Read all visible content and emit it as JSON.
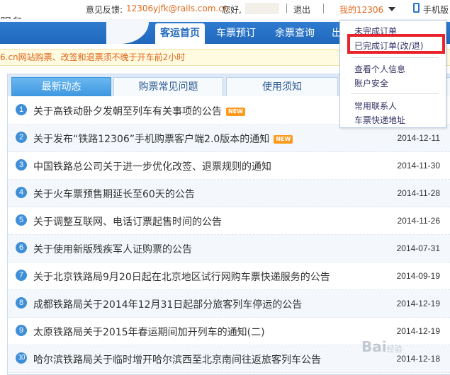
{
  "header": {
    "brand_fragment": "服务",
    "feedback_label": "意见反馈:",
    "feedback_email": "12306yjfk@rails.com.cn",
    "greeting": "您好,",
    "logout": "退出",
    "my_account": "我的12306",
    "mobile": "手机版"
  },
  "nav": {
    "items": [
      "客运首页",
      "车票预订",
      "余票查询",
      "出行"
    ]
  },
  "notice": {
    "text": "6.cn网站购票、改签和退票须不晚于开车前2小时"
  },
  "tabs": [
    "最新动态",
    "购票常见问题",
    "使用须知",
    ""
  ],
  "news": [
    {
      "num": "1",
      "title": "关于高铁动卧夕发朝至列车有关事项的公告",
      "badge": "NEW",
      "date": ""
    },
    {
      "num": "2",
      "title": "关于发布“铁路12306”手机购票客户端2.0版本的通知",
      "badge": "NEW",
      "date": "2014-12-11"
    },
    {
      "num": "3",
      "title": "中国铁路总公司关于进一步优化改签、退票规则的通知",
      "badge": "",
      "date": "2014-11-30"
    },
    {
      "num": "4",
      "title": "关于火车票预售期延长至60天的公告",
      "badge": "",
      "date": "2014-11-28"
    },
    {
      "num": "5",
      "title": "关于调整互联网、电话订票起售时间的公告",
      "badge": "",
      "date": "2014-11-26"
    },
    {
      "num": "6",
      "title": "关于使用新版残疾军人证购票的公告",
      "badge": "",
      "date": "2014-07-31"
    },
    {
      "num": "7",
      "title": "关于北京铁路局9月20日起在北京地区试行网购车票快递服务的公告",
      "badge": "",
      "date": "2014-09-19"
    },
    {
      "num": "8",
      "title": "成都铁路局关于2014年12月31日起部分旅客列车停运的公告",
      "badge": "",
      "date": "2014-12-19"
    },
    {
      "num": "9",
      "title": "太原铁路局关于2015年春运期间加开列车的通知(二)",
      "badge": "",
      "date": "2014-12-19"
    },
    {
      "num": "10",
      "title": "哈尔滨铁路局关于临时增开哈尔滨西至北京南间往返旅客列车公告",
      "badge": "",
      "date": "2014-12-18"
    }
  ],
  "dropdown": {
    "items": [
      "未完成订单",
      "已完成订单(改/退)",
      "查看个人信息",
      "账户安全",
      "常用联系人",
      "车票快递地址"
    ]
  },
  "watermark": {
    "text": "Bai",
    "suffix": "经验"
  },
  "colors": {
    "nav_blue": "#2168bd",
    "accent_orange": "#e26a1d",
    "highlight_red": "#e8232b",
    "badge_orange": "#ff9a1f"
  }
}
